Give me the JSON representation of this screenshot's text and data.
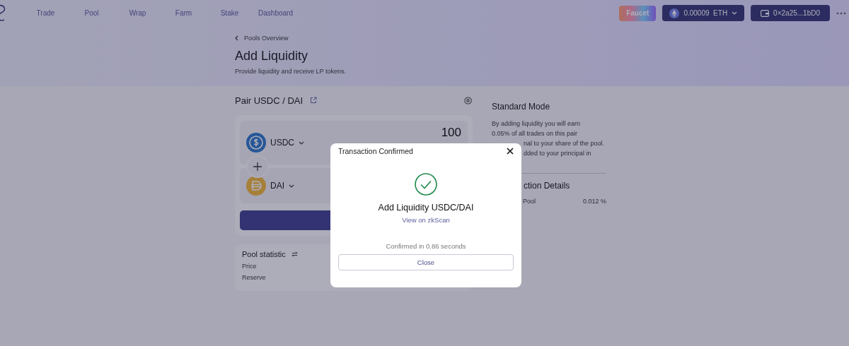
{
  "nav": {
    "items": [
      "Trade",
      "Pool",
      "Wrap",
      "Farm",
      "Stake",
      "Dashboard"
    ]
  },
  "header_actions": {
    "faucet": "Faucet",
    "balance": "0.00009",
    "balance_unit": "ETH",
    "wallet": "0×2a25...1bD0"
  },
  "breadcrumb": "Pools Overview",
  "title": "Add Liquidity",
  "subtitle": "Provide liquidity and receive LP tokens.",
  "pair": "Pair USDC / DAI",
  "tokens": [
    {
      "symbol": "USDC",
      "kind": "usdc",
      "amount": "100"
    },
    {
      "symbol": "DAI",
      "kind": "dai"
    }
  ],
  "pool_statistic": {
    "title": "Pool statistic",
    "rows": [
      "Price",
      "Reserve"
    ]
  },
  "side": {
    "title": "Standard Mode",
    "lines": [
      {
        "text": "By adding liquidity you will earn",
        "covered": false
      },
      {
        "text": "0.05% of all trades on this pair",
        "covered": false
      },
      {
        "text": "nal to your share of the pool.",
        "covered": true
      },
      {
        "text": "dded to your principal in",
        "covered": true
      }
    ],
    "details_title": "ction Details",
    "details_rows": [
      {
        "label": "Pool",
        "value": "0.012 %"
      }
    ]
  },
  "modal": {
    "title": "Transaction Confirmed",
    "heading": "Add Liquidity USDC/DAI",
    "link": "View on zkScan",
    "note": "Confirmed in 0.86 seconds",
    "button": "Close"
  }
}
